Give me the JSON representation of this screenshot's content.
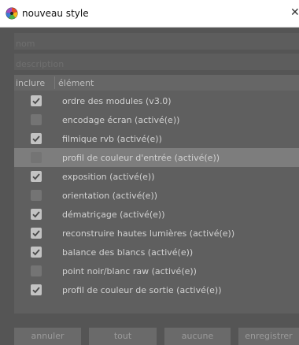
{
  "window": {
    "title": "nouveau style",
    "close_glyph": "✕"
  },
  "form": {
    "name_placeholder": "nom",
    "description_placeholder": "description"
  },
  "list": {
    "header": {
      "include": "inclure",
      "element": "élément"
    },
    "rows": [
      {
        "label": "ordre des modules (v3.0)",
        "checked": true,
        "selected": false
      },
      {
        "label": "encodage écran  (activé(e))",
        "checked": false,
        "selected": false
      },
      {
        "label": "filmique rvb  (activé(e))",
        "checked": true,
        "selected": false
      },
      {
        "label": "profil de couleur d'entrée  (activé(e))",
        "checked": false,
        "selected": true
      },
      {
        "label": "exposition  (activé(e))",
        "checked": true,
        "selected": false
      },
      {
        "label": "orientation  (activé(e))",
        "checked": false,
        "selected": false
      },
      {
        "label": "dématriçage  (activé(e))",
        "checked": true,
        "selected": false
      },
      {
        "label": "reconstruire hautes lumières  (activé(e))",
        "checked": true,
        "selected": false
      },
      {
        "label": "balance des blancs  (activé(e))",
        "checked": true,
        "selected": false
      },
      {
        "label": "point noir/blanc raw  (activé(e))",
        "checked": false,
        "selected": false
      },
      {
        "label": "profil de couleur de sortie  (activé(e))",
        "checked": true,
        "selected": false
      }
    ]
  },
  "buttons": {
    "cancel": "annuler",
    "all": "tout",
    "none": "aucune",
    "save": "enregistrer"
  },
  "icons": {
    "app": "darktable-icon",
    "check": "checkmark-icon"
  }
}
